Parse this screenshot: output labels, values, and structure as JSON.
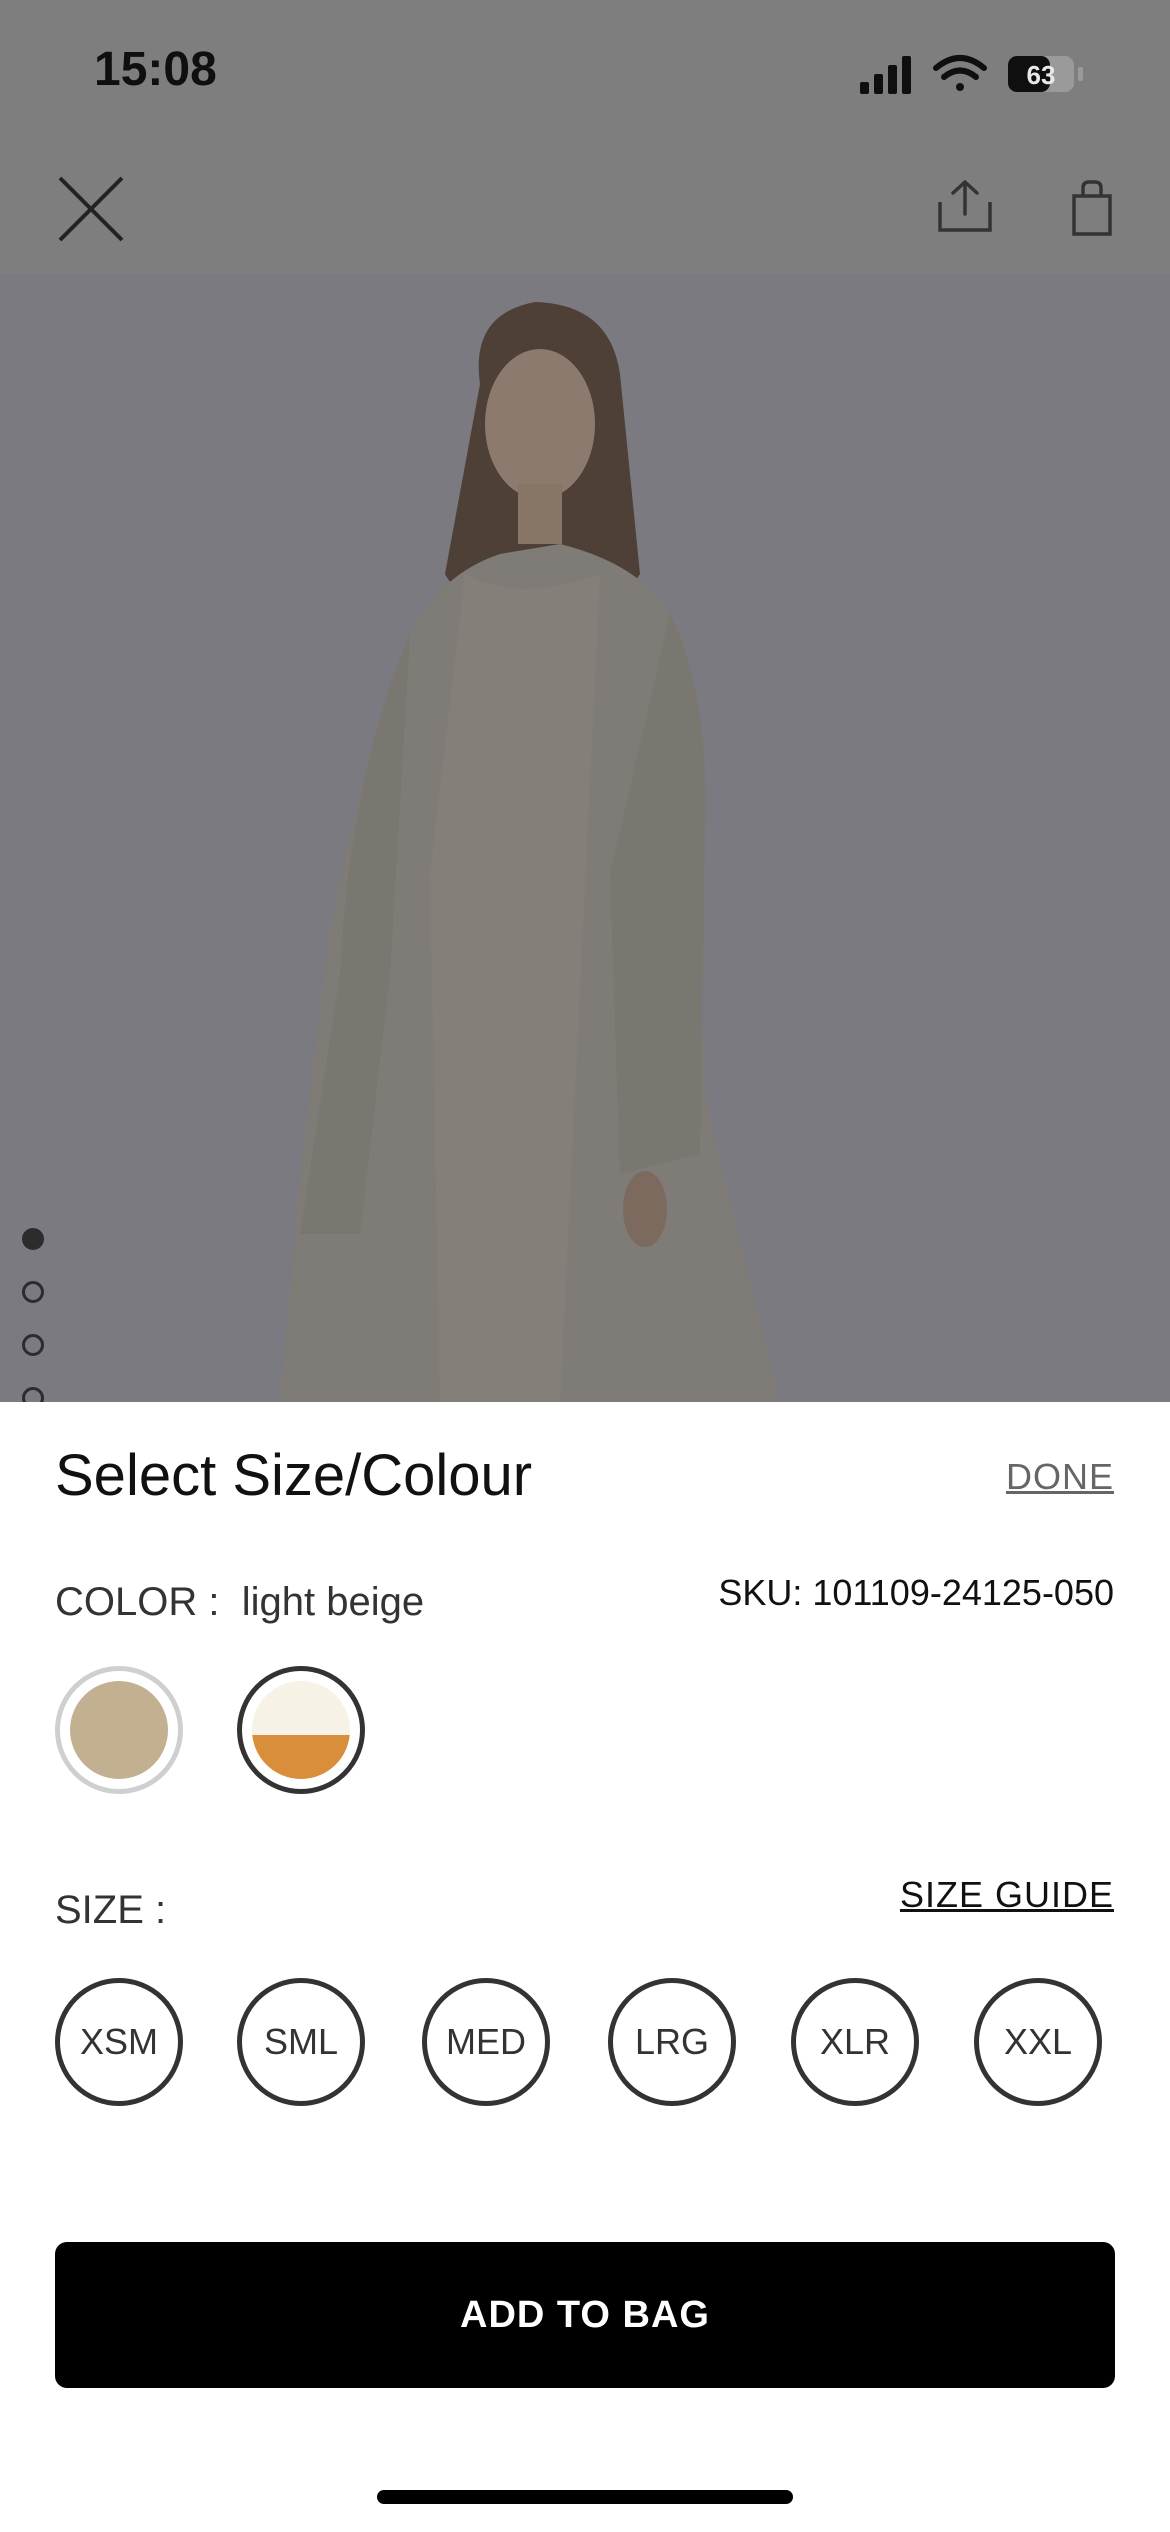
{
  "status_bar": {
    "time": "15:08",
    "battery": "63"
  },
  "header": {
    "close_icon": "close-icon",
    "share_icon": "share-icon",
    "bag_icon": "shopping-bag-icon"
  },
  "gallery": {
    "image_count": 7,
    "active_index": 0
  },
  "sheet": {
    "title": "Select Size/Colour",
    "done_label": "DONE",
    "color_label": "COLOR :",
    "color_value": "light beige",
    "sku": "SKU: 101109-24125-050",
    "swatches": [
      {
        "color": "#c2b091",
        "selected": true
      },
      {
        "color_top": "#f6f2e6",
        "color_bottom": "#d98e3c",
        "selected": false
      }
    ],
    "size_label": "SIZE :",
    "size_guide_label": "SIZE GUIDE",
    "sizes": [
      "XSM",
      "SML",
      "MED",
      "LRG",
      "XLR",
      "XXL"
    ],
    "add_to_bag_label": "ADD TO BAG"
  }
}
